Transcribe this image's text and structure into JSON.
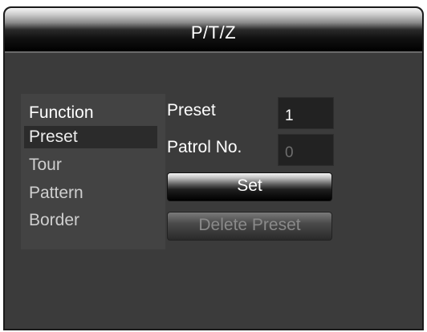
{
  "window": {
    "title": "P/T/Z"
  },
  "menu": {
    "header": "Function",
    "items": [
      {
        "label": "Preset",
        "selected": true
      },
      {
        "label": "Tour",
        "selected": false
      },
      {
        "label": "Pattern",
        "selected": false
      },
      {
        "label": "Border",
        "selected": false
      }
    ]
  },
  "form": {
    "preset_label": "Preset",
    "preset_value": "1",
    "patrol_label": "Patrol No.",
    "patrol_value": "0"
  },
  "buttons": {
    "set_label": "Set",
    "delete_label": "Delete Preset"
  },
  "colors": {
    "panel_bg": "#3b3b3b",
    "menu_bg": "#434343",
    "selected_bg": "#2b2b2b",
    "field_bg": "#222222"
  }
}
